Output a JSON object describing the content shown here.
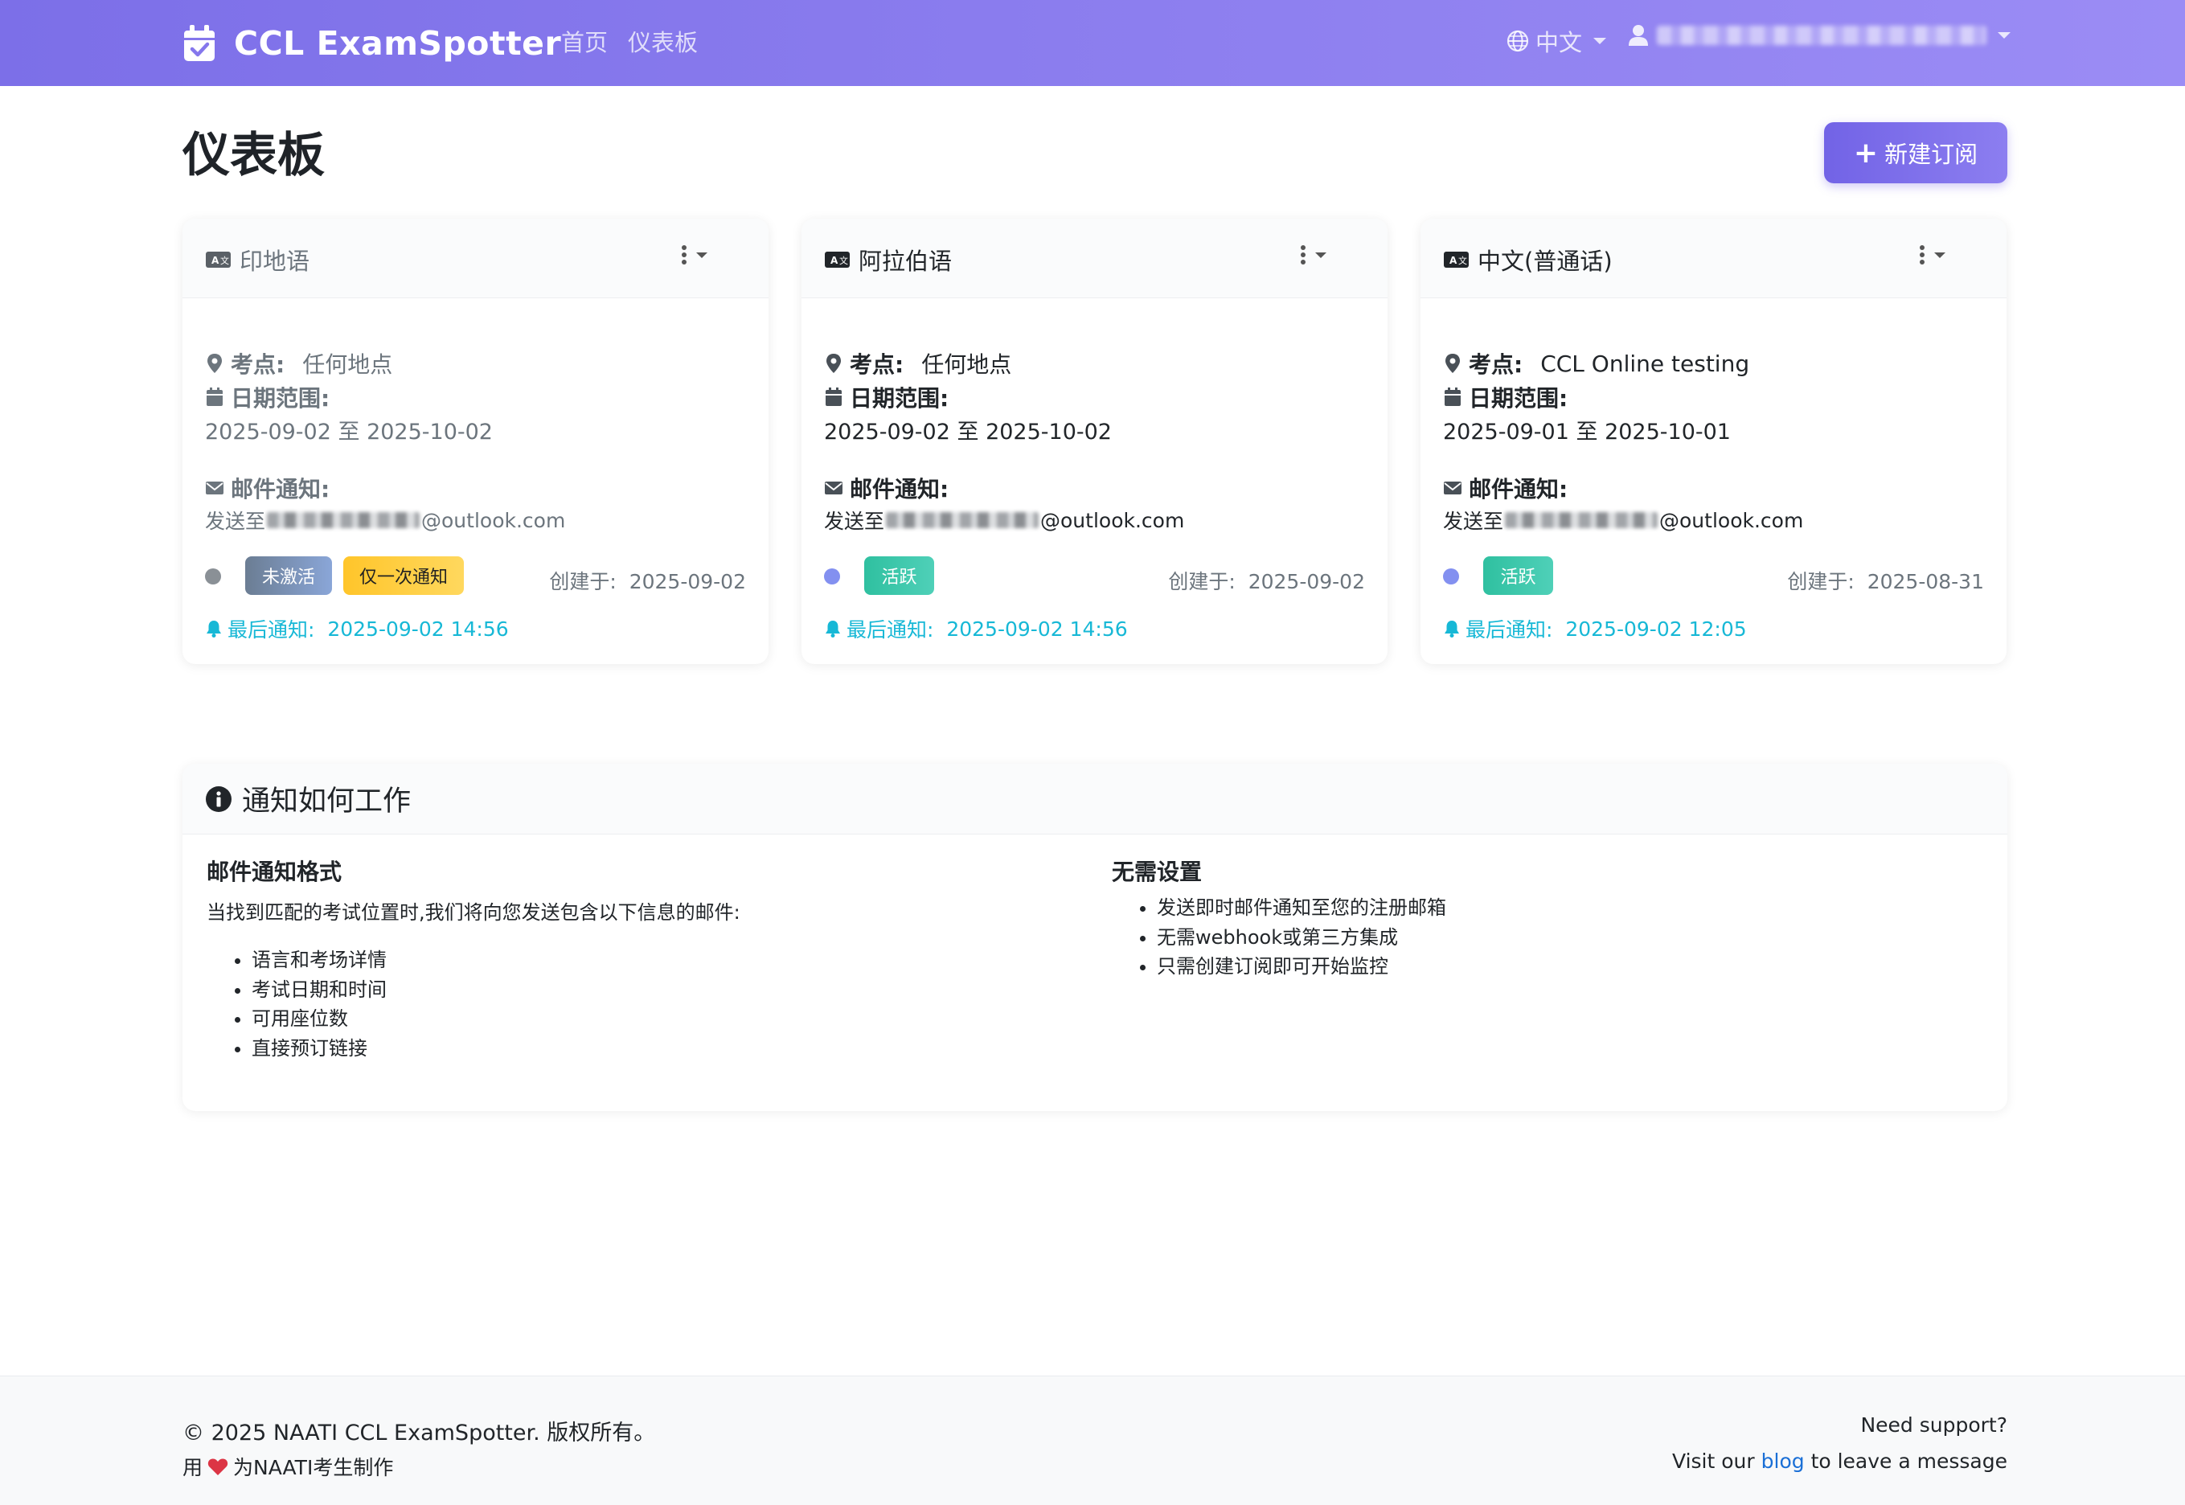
{
  "navbar": {
    "brand": "CCL ExamSpotter",
    "links": [
      "首页",
      "仪表板"
    ],
    "language": "中文",
    "user_icon": "user-icon"
  },
  "page": {
    "title": "仪表板",
    "new_subscription": "新建订阅"
  },
  "labels": {
    "location": "考点:",
    "date_range": "日期范围:",
    "email": "邮件通知:",
    "send_to_prefix": "发送至",
    "email_suffix": "@outlook.com",
    "created_prefix": "创建于:",
    "last_notify_prefix": "最后通知:"
  },
  "cards": [
    {
      "language": "印地语",
      "location": "任何地点",
      "date_range": "2025-09-02 至 2025-10-02",
      "badges": [
        "未激活",
        "仅一次通知"
      ],
      "created": "2025-09-02",
      "last_notified": "2025-09-02 14:56",
      "status_color": "#8a9096"
    },
    {
      "language": "阿拉伯语",
      "location": "任何地点",
      "date_range": "2025-09-02 至 2025-10-02",
      "badges": [
        "活跃"
      ],
      "created": "2025-09-02",
      "last_notified": "2025-09-02 14:56",
      "status_color": "#8390f0"
    },
    {
      "language": "中文(普通话)",
      "location": "CCL Online testing",
      "date_range": "2025-09-01 至 2025-10-01",
      "badges": [
        "活跃"
      ],
      "created": "2025-08-31",
      "last_notified": "2025-09-02 12:05",
      "status_color": "#8390f0"
    }
  ],
  "info": {
    "title": "通知如何工作",
    "left": {
      "heading": "邮件通知格式",
      "intro": "当找到匹配的考试位置时,我们将向您发送包含以下信息的邮件:",
      "items": [
        "语言和考场详情",
        "考试日期和时间",
        "可用座位数",
        "直接预订链接"
      ]
    },
    "right": {
      "heading": "无需设置",
      "items": [
        "发送即时邮件通知至您的注册邮箱",
        "无需webhook或第三方集成",
        "只需创建订阅即可开始监控"
      ]
    }
  },
  "footer": {
    "copyright": "© 2025 NAATI CCL ExamSpotter. 版权所有。",
    "made_prefix": "用",
    "made_suffix": "为NAATI考生制作",
    "support": "Need support?",
    "visit_prefix": "Visit our",
    "visit_link": "blog",
    "visit_suffix": "to leave a message"
  },
  "colors": {
    "brand_gradient_start": "#7c6fe8",
    "brand_gradient_end": "#9b8cf5",
    "active_badge": "#3cc7a8",
    "inactive_badge": "#6b7d93",
    "once_badge": "#ffc82c",
    "notify_cyan": "#17b8d6"
  }
}
